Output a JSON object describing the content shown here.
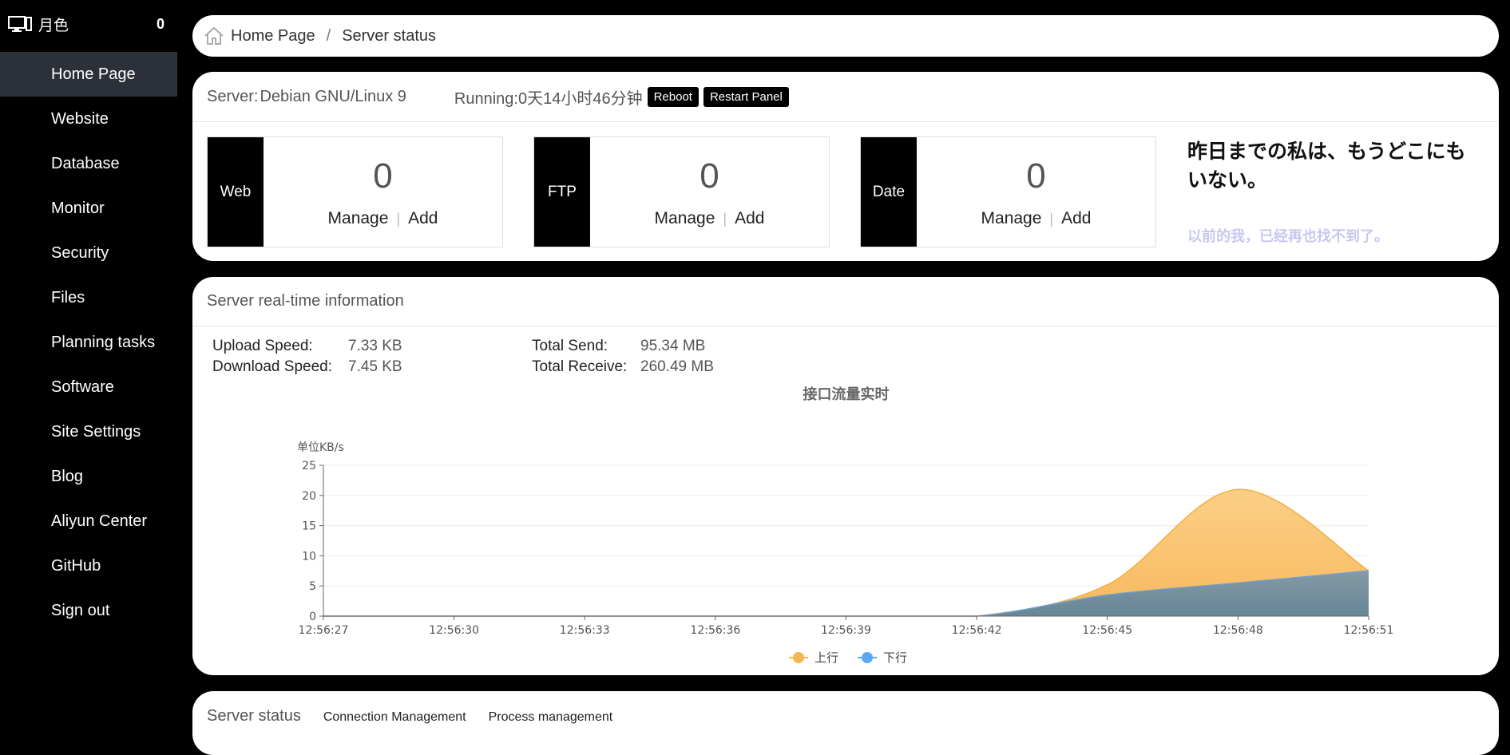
{
  "sidebar": {
    "title": "月色",
    "count": "0",
    "items": [
      {
        "label": "Home Page",
        "active": true
      },
      {
        "label": "Website"
      },
      {
        "label": "Database"
      },
      {
        "label": "Monitor"
      },
      {
        "label": "Security"
      },
      {
        "label": "Files"
      },
      {
        "label": "Planning tasks"
      },
      {
        "label": "Software"
      },
      {
        "label": "Site Settings"
      },
      {
        "label": "Blog"
      },
      {
        "label": "Aliyun Center"
      },
      {
        "label": "GitHub"
      },
      {
        "label": "Sign out"
      }
    ]
  },
  "breadcrumb": {
    "home": "Home Page",
    "current": "Server status",
    "separator": "/"
  },
  "server": {
    "label": "Server:",
    "os": "Debian GNU/Linux 9",
    "running": "Running:0天14小时46分钟",
    "reboot_label": "Reboot",
    "restart_label": "Restart Panel"
  },
  "stats": [
    {
      "tag": "Web",
      "value": "0",
      "manage": "Manage",
      "add": "Add"
    },
    {
      "tag": "FTP",
      "value": "0",
      "manage": "Manage",
      "add": "Add"
    },
    {
      "tag": "Date",
      "value": "0",
      "manage": "Manage",
      "add": "Add"
    }
  ],
  "quote": {
    "jp": "昨日までの私は、もうどこにもいない。",
    "cn": "以前的我，已经再也找不到了。"
  },
  "realtime": {
    "title": "Server real-time information",
    "upload_label": "Upload Speed:",
    "upload_value": "7.33 KB",
    "download_label": "Download Speed:",
    "download_value": "7.45 KB",
    "send_label": "Total Send:",
    "send_value": "95.34 MB",
    "receive_label": "Total Receive:",
    "receive_value": "260.49 MB"
  },
  "chart_data": {
    "type": "area",
    "title": "接口流量实时",
    "ylabel": "单位KB/s",
    "ylim": [
      0,
      25
    ],
    "yticks": [
      0,
      5,
      10,
      15,
      20,
      25
    ],
    "x": [
      "12:56:27",
      "12:56:30",
      "12:56:33",
      "12:56:36",
      "12:56:39",
      "12:56:42",
      "12:56:45",
      "12:56:48",
      "12:56:51"
    ],
    "series": [
      {
        "name": "上行",
        "color": "#f5b74e",
        "values": [
          0,
          0,
          0,
          0,
          0,
          0,
          5.2,
          21,
          7.5
        ]
      },
      {
        "name": "下行",
        "color": "#5aa8f0",
        "values": [
          0,
          0,
          0,
          0,
          0,
          0,
          3.5,
          5.5,
          7.5
        ]
      }
    ],
    "grid": true,
    "legend": "bottom"
  },
  "status": {
    "title": "Server status",
    "connection": "Connection Management",
    "process": "Process management"
  }
}
